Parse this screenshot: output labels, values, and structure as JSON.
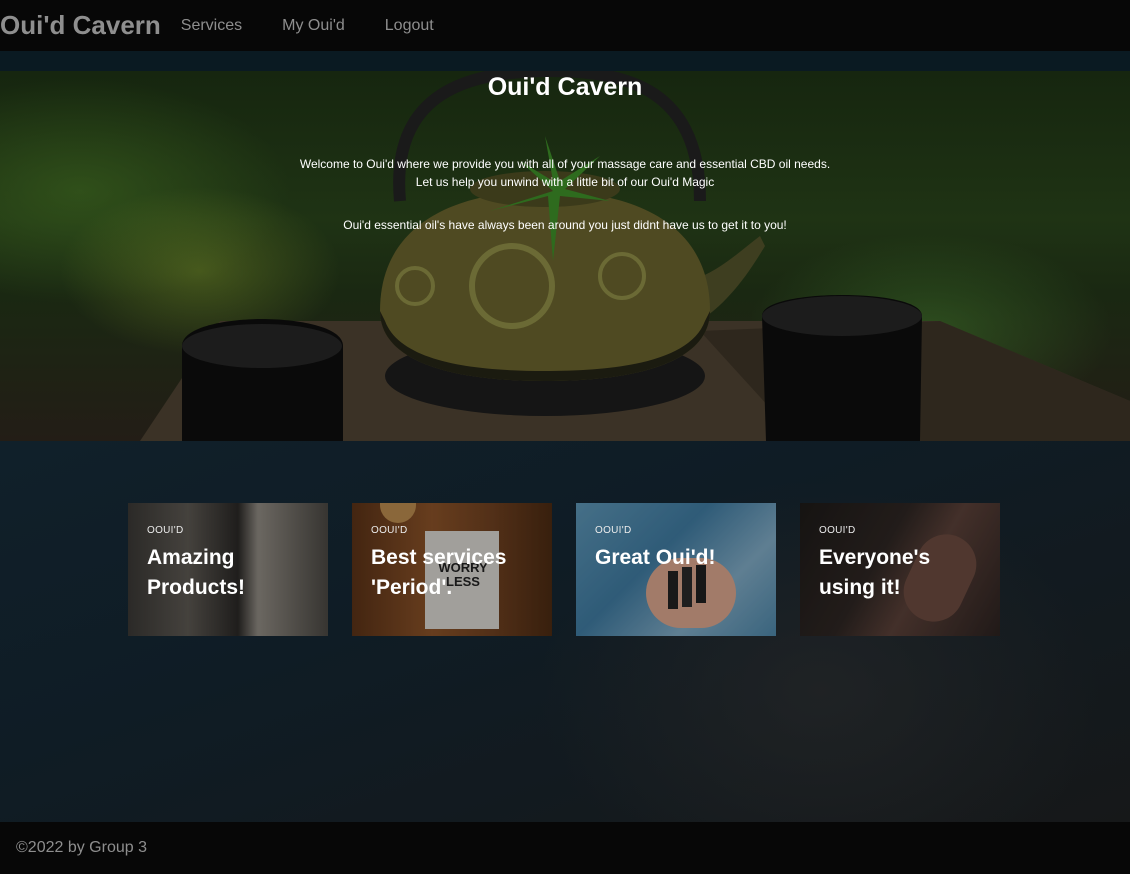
{
  "nav": {
    "brand": "Oui'd Cavern",
    "links": [
      "Services",
      "My Oui'd",
      "Logout"
    ]
  },
  "hero": {
    "title": "Oui'd Cavern",
    "line1": "Welcome to Oui'd where we provide you with all of your massage care and essential CBD oil needs.",
    "line2": "Let us help you unwind with a little bit of our Oui'd Magic",
    "line3": "Oui'd essential oil's have always been around you just didnt have us to get it to you!"
  },
  "cards": [
    {
      "kicker": "OOUI'D",
      "title": "Amazing Products!"
    },
    {
      "kicker": "OOUI'D",
      "title": "Best services 'Period'."
    },
    {
      "kicker": "OOUI'D",
      "title": "Great Oui'd!"
    },
    {
      "kicker": "OOUI'D",
      "title": "Everyone's using it!"
    }
  ],
  "card_images": {
    "card1": "cozy-room-image",
    "card2": "worry-less-sign-image",
    "card3": "essential-oil-bottles-image",
    "card4": "hands-image"
  },
  "card2_sign": "WORRY LESS",
  "footer": {
    "copyright": "©2022 by Group 3"
  },
  "colors": {
    "nav_bg": "#070707",
    "nav_text": "#8e8e8e",
    "page_bg": "#0d1419"
  }
}
